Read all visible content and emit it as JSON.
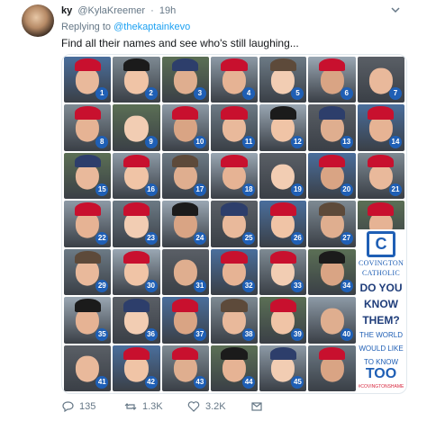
{
  "tweet": {
    "display_name": "ky",
    "handle": "@KylaKreemer",
    "time": "19h",
    "reply_prefix": "Replying to",
    "reply_to": "@thekaptainkevo",
    "text": "Find all their names and see who's still laughing..."
  },
  "image": {
    "numbers": [
      "1",
      "2",
      "3",
      "4",
      "5",
      "6",
      "7",
      "8",
      "9",
      "10",
      "11",
      "12",
      "13",
      "14",
      "15",
      "16",
      "17",
      "18",
      "19",
      "20",
      "21",
      "22",
      "23",
      "24",
      "25",
      "26",
      "27",
      "28",
      "29",
      "30",
      "31",
      "32",
      "33",
      "34",
      "35",
      "36",
      "37",
      "38",
      "39",
      "40",
      "41",
      "42",
      "43",
      "44",
      "45"
    ],
    "logo_letter": "C",
    "logo_line1": "COVINGTON",
    "logo_line2": "CATHOLIC",
    "logo_q1": "DO YOU",
    "logo_q2": "KNOW",
    "logo_q3": "THEM?",
    "world_line1": "THE WORLD",
    "world_line2": "WOULD LIKE",
    "world_line3": "TO KNOW",
    "too": "TOO",
    "hashtag": "#COVINGTONSHAME"
  },
  "actions": {
    "replies": "135",
    "retweets": "1.3K",
    "likes": "3.2K"
  },
  "colors": {
    "accent": "#1da1f2",
    "muted": "#657786",
    "badge": "#1f5fb5",
    "hat": "#c8102e"
  }
}
